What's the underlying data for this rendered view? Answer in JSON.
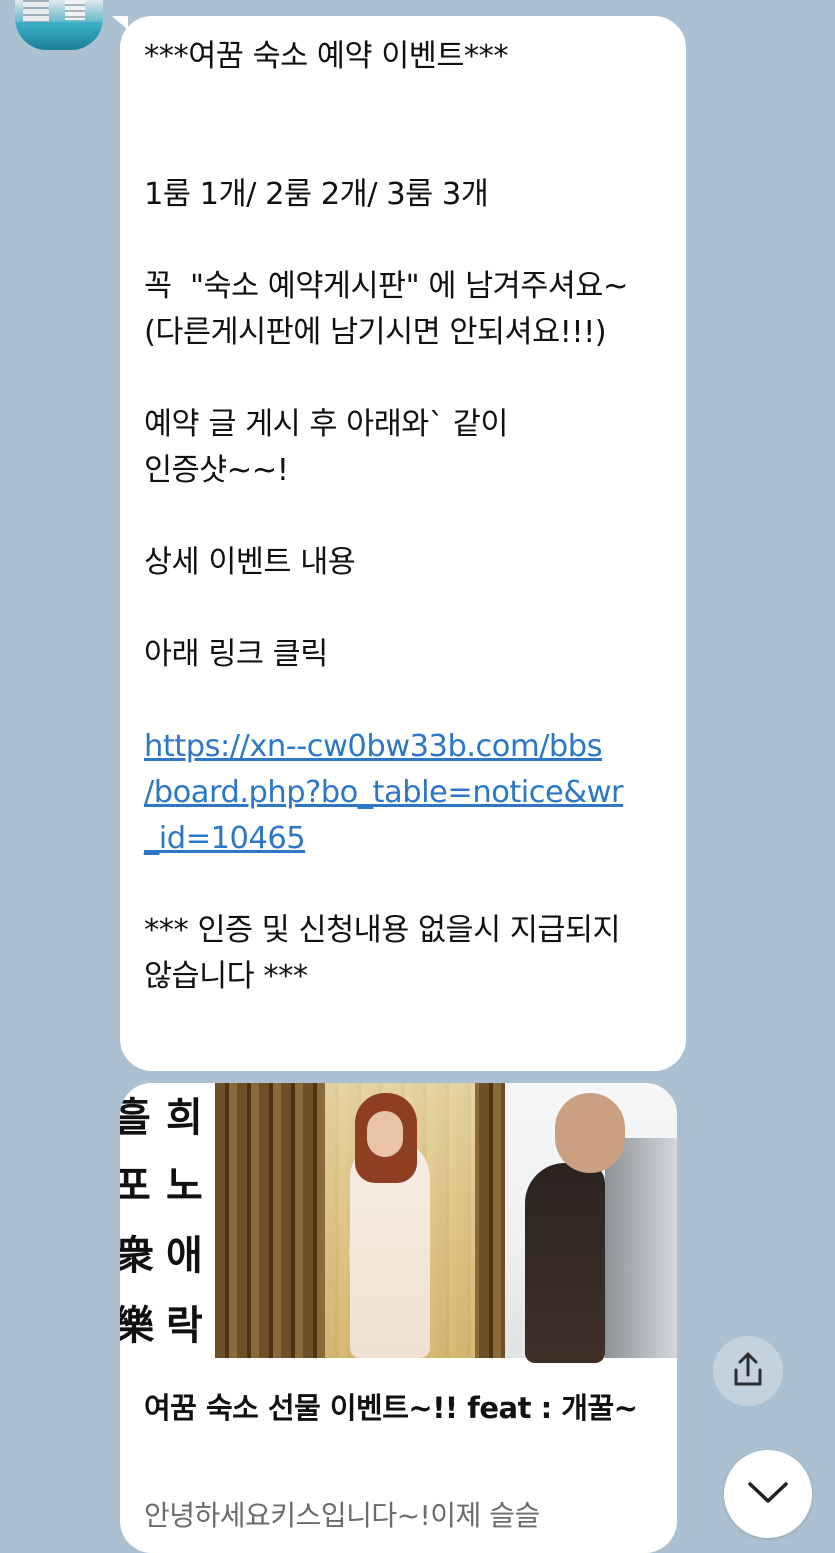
{
  "message": {
    "lines": [
      "***여꿈 숙소 예약 이벤트***",
      "",
      "",
      "1룸 1개/ 2룸 2개/ 3룸 3개",
      "",
      "꼭  \"숙소 예약게시판\" 에 남겨주셔요~",
      "(다른게시판에 남기시면 안되셔요!!!)",
      "",
      "예약 글 게시 후 아래와` 같이",
      "인증샷~~!",
      "",
      "상세 이벤트 내용",
      "",
      "아래 링크 클릭",
      ""
    ],
    "link_lines": [
      "https://xn--cw0bw33b.com/bbs",
      "/board.php?bo_table=notice&wr",
      "_id=10465"
    ],
    "footer_lines": [
      "",
      "*** 인증 및 신청내용 없을시 지급되지",
      "않습니다 ***"
    ]
  },
  "preview_card": {
    "calligraphy_left": [
      "흘",
      "포",
      "衆",
      "樂"
    ],
    "calligraphy_right": [
      "희",
      "노",
      "애",
      "락"
    ],
    "title": "여꿈 숙소 선물 이벤트~!! feat : 개꿀~",
    "description": "안녕하세요키스입니다~!이제 슬슬"
  },
  "icons": {
    "share": "share-icon",
    "scroll_down": "chevron-down-icon"
  }
}
